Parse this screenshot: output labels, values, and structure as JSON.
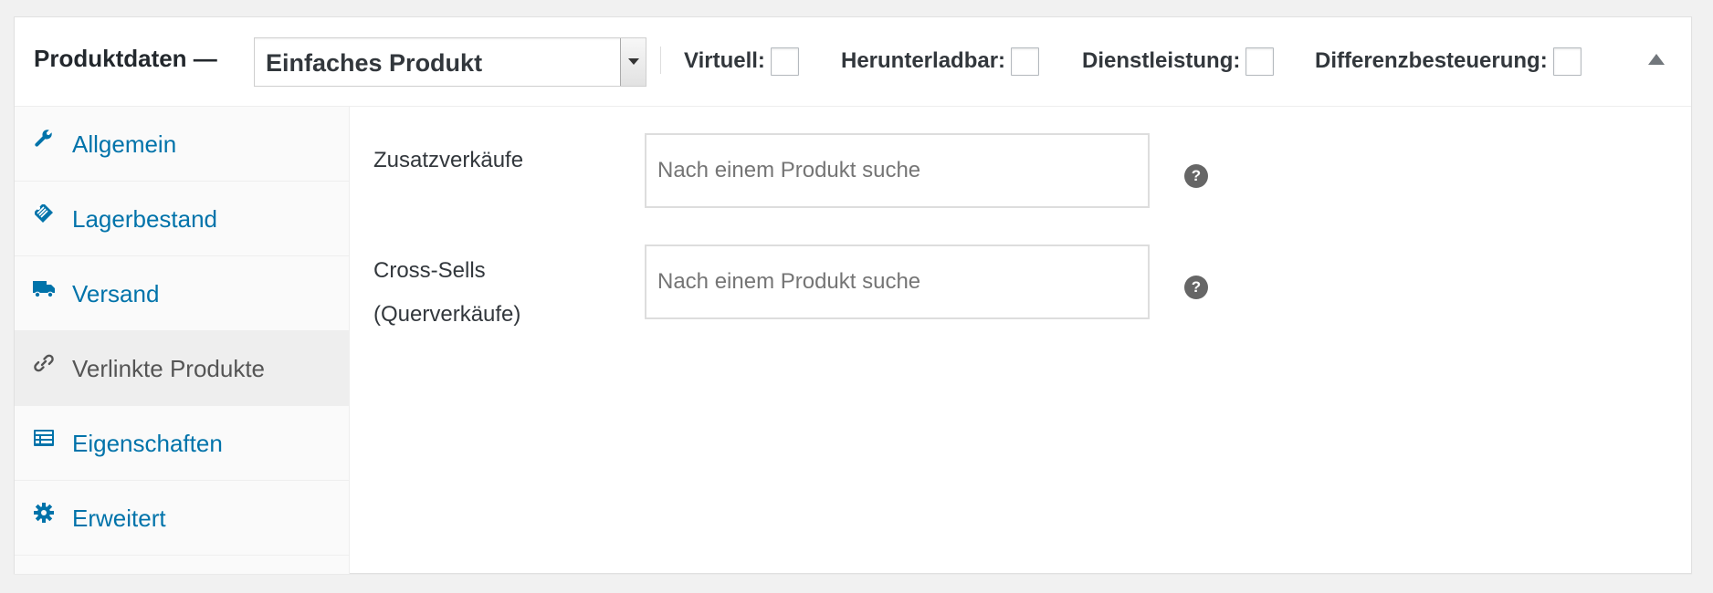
{
  "header": {
    "title": "Produktdaten —",
    "product_type": "Einfaches Produkt",
    "options": {
      "virtual": "Virtuell:",
      "downloadable": "Herunterladbar:",
      "service": "Dienstleistung:",
      "margin_tax": "Differenzbesteuerung:"
    }
  },
  "tabs": [
    {
      "label": "Allgemein",
      "icon": "wrench-icon"
    },
    {
      "label": "Lagerbestand",
      "icon": "tag-icon"
    },
    {
      "label": "Versand",
      "icon": "truck-icon"
    },
    {
      "label": "Verlinkte Produkte",
      "icon": "link-icon",
      "active": true
    },
    {
      "label": "Eigenschaften",
      "icon": "list-card-icon"
    },
    {
      "label": "Erweitert",
      "icon": "gear-icon"
    }
  ],
  "fields": {
    "upsells": {
      "label": "Zusatzverkäufe",
      "placeholder": "Nach einem Produkt suche",
      "help": "?"
    },
    "cross_sells": {
      "label": "Cross-Sells (Querverkäufe)",
      "placeholder": "Nach einem Produkt suche",
      "help": "?"
    }
  },
  "colors": {
    "link": "#0073aa",
    "active_tab_bg": "#eeeeee",
    "sidebar_bg": "#fafafa",
    "help_icon": "#666666"
  }
}
